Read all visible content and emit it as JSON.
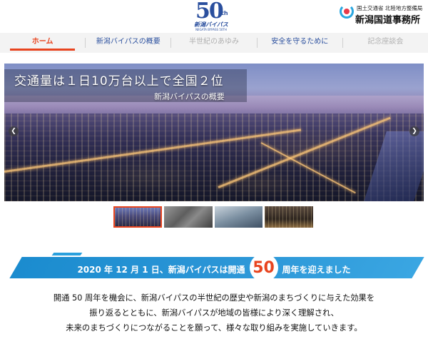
{
  "header": {
    "logo": {
      "number": "50",
      "suffix": "th",
      "name": "新潟バイパス",
      "english": "NIIGATA BYPASS 50TH"
    },
    "office": {
      "ministry": "国土交通省 北陸地方整備局",
      "name": "新潟国道事務所"
    }
  },
  "nav": {
    "items": [
      {
        "label": "ホーム",
        "state": "active"
      },
      {
        "label": "新潟バイパスの概要",
        "state": "normal"
      },
      {
        "label": "半世紀のあゆみ",
        "state": "disabled"
      },
      {
        "label": "安全を守るために",
        "state": "normal"
      },
      {
        "label": "記念座談会",
        "state": "disabled"
      }
    ]
  },
  "hero": {
    "title": "交通量は１日10万台以上で全国２位",
    "subtitle": "新潟バイパスの概要",
    "prev_icon": "chevron-left-icon",
    "next_icon": "chevron-right-icon"
  },
  "thumbnails": [
    {
      "name": "night-city-thumbnail",
      "selected": true
    },
    {
      "name": "highway-thumbnail",
      "selected": false
    },
    {
      "name": "road-work-thumbnail",
      "selected": false
    },
    {
      "name": "ceremony-thumbnail",
      "selected": false
    }
  ],
  "anniversary": {
    "before": "2020 年 12 月 1 日、新潟バイパスは開通",
    "number": "50",
    "after": "周年を迎えました"
  },
  "intro": {
    "lines": [
      "開通 50 周年を機会に、新潟バイパスの半世紀の歴史や新潟のまちづくりに与えた効果を",
      "振り返るとともに、新潟バイパスが地域の皆様により深く理解され、",
      "未来のまちづくりにつながることを願って、様々な取り組みを実施していきます。"
    ]
  },
  "colors": {
    "brand_blue": "#2a4f9e",
    "accent_orange": "#e8441f",
    "banner_blue": "#2a95d6"
  }
}
